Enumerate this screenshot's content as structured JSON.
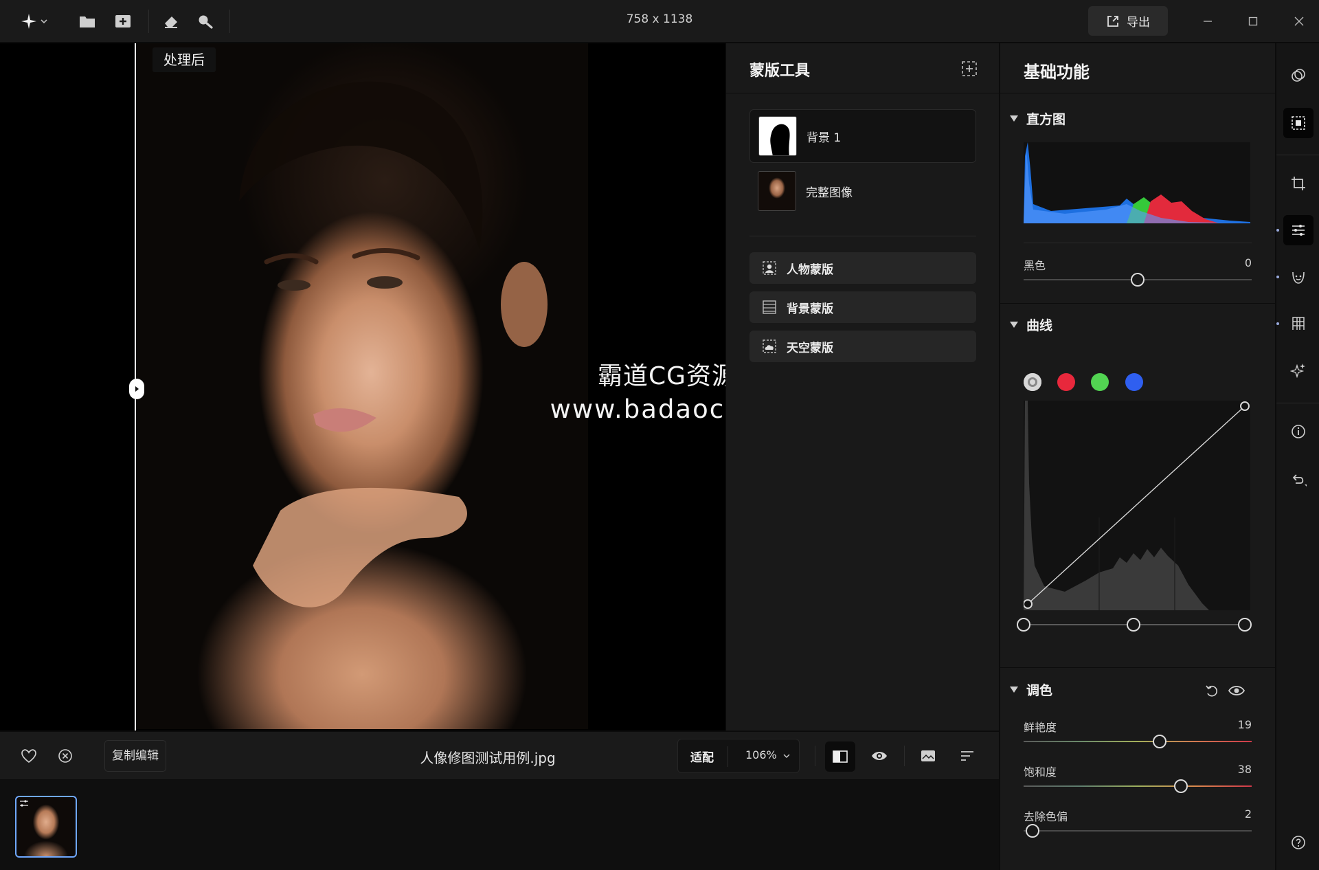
{
  "titlebar": {
    "doc_size": "758 x 1138",
    "export_label": "导出"
  },
  "canvas": {
    "after_label": "处理后",
    "watermark_line1": "霸道CG资源网",
    "watermark_line2": "www.badaocg.com"
  },
  "mask_panel": {
    "title": "蒙版工具",
    "layers": [
      {
        "name": "背景 1",
        "active": true
      },
      {
        "name": "完整图像",
        "active": false
      }
    ],
    "mask_buttons": [
      {
        "label": "人物蒙版",
        "icon": "person-mask-icon"
      },
      {
        "label": "背景蒙版",
        "icon": "background-mask-icon"
      },
      {
        "label": "天空蒙版",
        "icon": "sky-mask-icon"
      }
    ]
  },
  "adjust_panel": {
    "title": "基础功能",
    "histogram": {
      "label": "直方图"
    },
    "black": {
      "label": "黑色",
      "value": "0",
      "position": 0.5
    },
    "curves": {
      "label": "曲线",
      "channels": [
        "#d8d8d8",
        "#e8283c",
        "#52d452",
        "#2f5ff0"
      ]
    },
    "toning": {
      "label": "调色",
      "sliders": [
        {
          "label": "鲜艳度",
          "value": "19",
          "position": 0.595
        },
        {
          "label": "饱和度",
          "value": "38",
          "position": 0.69
        },
        {
          "label": "去除色偏",
          "value": "2",
          "position": 0.04
        }
      ]
    }
  },
  "bottombar": {
    "copy_edit": "复制编辑",
    "filename": "人像修图测试用例.jpg",
    "fit_label": "适配",
    "zoom": "106%"
  },
  "colors": {
    "accent": "#6fa8ff",
    "panel": "#191919",
    "button": "#262626"
  }
}
